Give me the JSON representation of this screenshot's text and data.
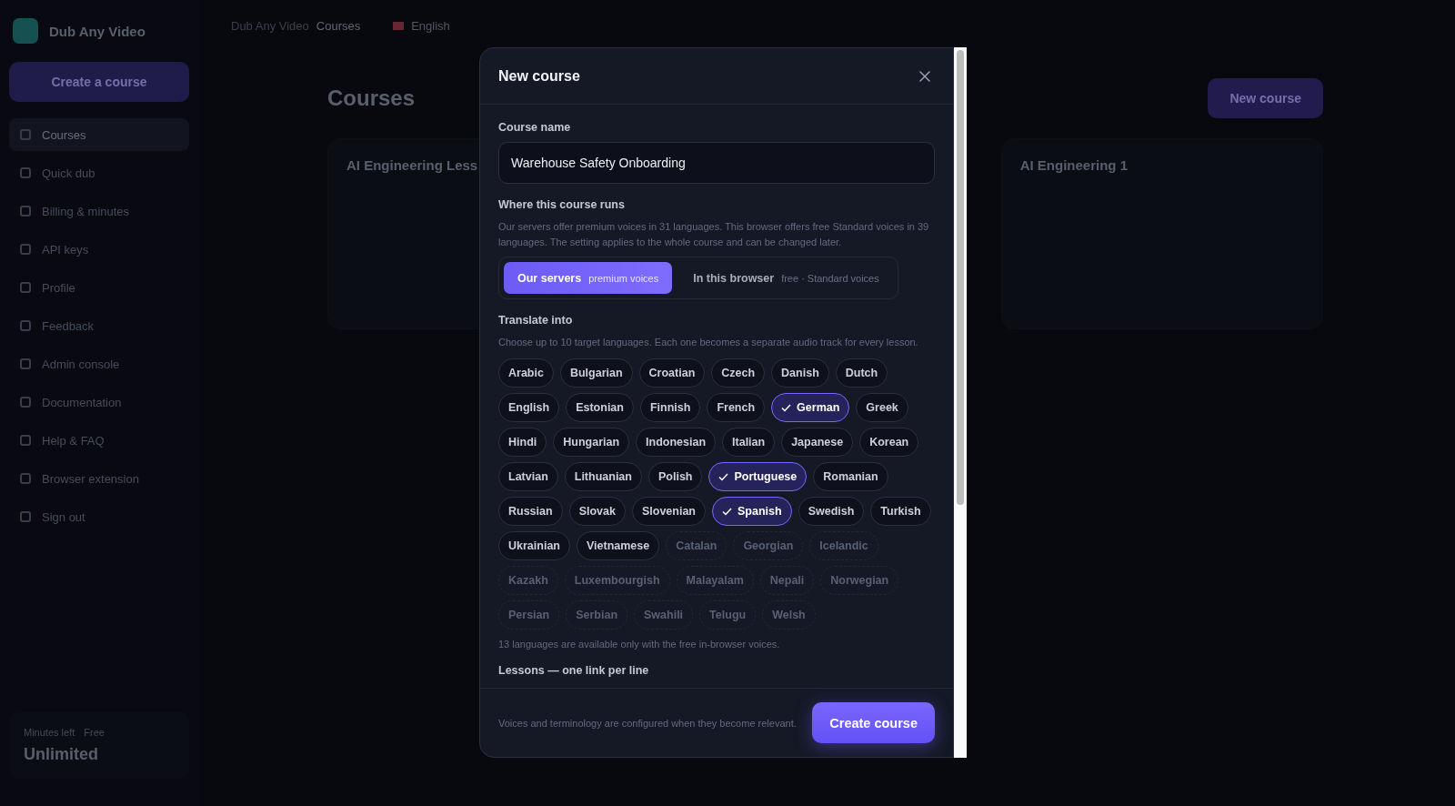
{
  "sidebar": {
    "brand": "Dub Any Video",
    "create_button": "Create a course",
    "items": [
      {
        "label": "Courses",
        "selected": true
      },
      {
        "label": "Quick dub",
        "selected": false
      },
      {
        "label": "Billing & minutes",
        "selected": false
      },
      {
        "label": "API keys",
        "selected": false
      },
      {
        "label": "Profile",
        "selected": false
      },
      {
        "label": "Feedback",
        "selected": false
      },
      {
        "label": "Admin console",
        "selected": false
      },
      {
        "label": "Documentation",
        "selected": false
      },
      {
        "label": "Help & FAQ",
        "selected": false
      },
      {
        "label": "Browser extension",
        "selected": false
      },
      {
        "label": "Sign out",
        "selected": false
      }
    ],
    "minutes": {
      "label": "Minutes left",
      "plan": "Free",
      "value": "Unlimited"
    }
  },
  "topbar": {
    "breadcrumb": [
      "Dub Any Video",
      "Courses"
    ],
    "language": "English"
  },
  "page": {
    "title": "Courses",
    "new_button": "New course",
    "cards": [
      {
        "title": "AI Engineering Less"
      },
      {
        "title": "AI Engineering 1"
      }
    ]
  },
  "dialog": {
    "title": "New course",
    "course_name": {
      "label": "Course name",
      "value": "Warehouse Safety Onboarding"
    },
    "runs": {
      "label": "Where this course runs",
      "help": "Our servers offer premium voices in 31 languages. This browser offers free Standard voices in 39 languages. The setting applies to the whole course and can be changed later.",
      "options": [
        {
          "label": "Our servers",
          "note": "premium voices",
          "selected": true
        },
        {
          "label": "In this browser",
          "note": "free · Standard voices",
          "selected": false
        }
      ]
    },
    "translate": {
      "label": "Translate into",
      "help": "Choose up to 10 target languages. Each one becomes a separate audio track for every lesson.",
      "languages": [
        {
          "name": "Arabic",
          "selected": false,
          "available": true
        },
        {
          "name": "Bulgarian",
          "selected": false,
          "available": true
        },
        {
          "name": "Croatian",
          "selected": false,
          "available": true
        },
        {
          "name": "Czech",
          "selected": false,
          "available": true
        },
        {
          "name": "Danish",
          "selected": false,
          "available": true
        },
        {
          "name": "Dutch",
          "selected": false,
          "available": true
        },
        {
          "name": "English",
          "selected": false,
          "available": true
        },
        {
          "name": "Estonian",
          "selected": false,
          "available": true
        },
        {
          "name": "Finnish",
          "selected": false,
          "available": true
        },
        {
          "name": "French",
          "selected": false,
          "available": true
        },
        {
          "name": "German",
          "selected": true,
          "available": true
        },
        {
          "name": "Greek",
          "selected": false,
          "available": true
        },
        {
          "name": "Hindi",
          "selected": false,
          "available": true
        },
        {
          "name": "Hungarian",
          "selected": false,
          "available": true
        },
        {
          "name": "Indonesian",
          "selected": false,
          "available": true
        },
        {
          "name": "Italian",
          "selected": false,
          "available": true
        },
        {
          "name": "Japanese",
          "selected": false,
          "available": true
        },
        {
          "name": "Korean",
          "selected": false,
          "available": true
        },
        {
          "name": "Latvian",
          "selected": false,
          "available": true
        },
        {
          "name": "Lithuanian",
          "selected": false,
          "available": true
        },
        {
          "name": "Polish",
          "selected": false,
          "available": true
        },
        {
          "name": "Portuguese",
          "selected": true,
          "available": true
        },
        {
          "name": "Romanian",
          "selected": false,
          "available": true
        },
        {
          "name": "Russian",
          "selected": false,
          "available": true
        },
        {
          "name": "Slovak",
          "selected": false,
          "available": true
        },
        {
          "name": "Slovenian",
          "selected": false,
          "available": true
        },
        {
          "name": "Spanish",
          "selected": true,
          "available": true
        },
        {
          "name": "Swedish",
          "selected": false,
          "available": true
        },
        {
          "name": "Turkish",
          "selected": false,
          "available": true
        },
        {
          "name": "Ukrainian",
          "selected": false,
          "available": true
        },
        {
          "name": "Vietnamese",
          "selected": false,
          "available": true
        },
        {
          "name": "Catalan",
          "selected": false,
          "available": false
        },
        {
          "name": "Georgian",
          "selected": false,
          "available": false
        },
        {
          "name": "Icelandic",
          "selected": false,
          "available": false
        },
        {
          "name": "Kazakh",
          "selected": false,
          "available": false
        },
        {
          "name": "Luxembourgish",
          "selected": false,
          "available": false
        },
        {
          "name": "Malayalam",
          "selected": false,
          "available": false
        },
        {
          "name": "Nepali",
          "selected": false,
          "available": false
        },
        {
          "name": "Norwegian",
          "selected": false,
          "available": false
        },
        {
          "name": "Persian",
          "selected": false,
          "available": false
        },
        {
          "name": "Serbian",
          "selected": false,
          "available": false
        },
        {
          "name": "Swahili",
          "selected": false,
          "available": false
        },
        {
          "name": "Telugu",
          "selected": false,
          "available": false
        },
        {
          "name": "Welsh",
          "selected": false,
          "available": false
        }
      ],
      "note": "13 languages are available only with the free in-browser voices."
    },
    "lessons_label": "Lessons — one link per line",
    "footer_note": "Voices and terminology are configured when they become relevant.",
    "submit": "Create course"
  }
}
